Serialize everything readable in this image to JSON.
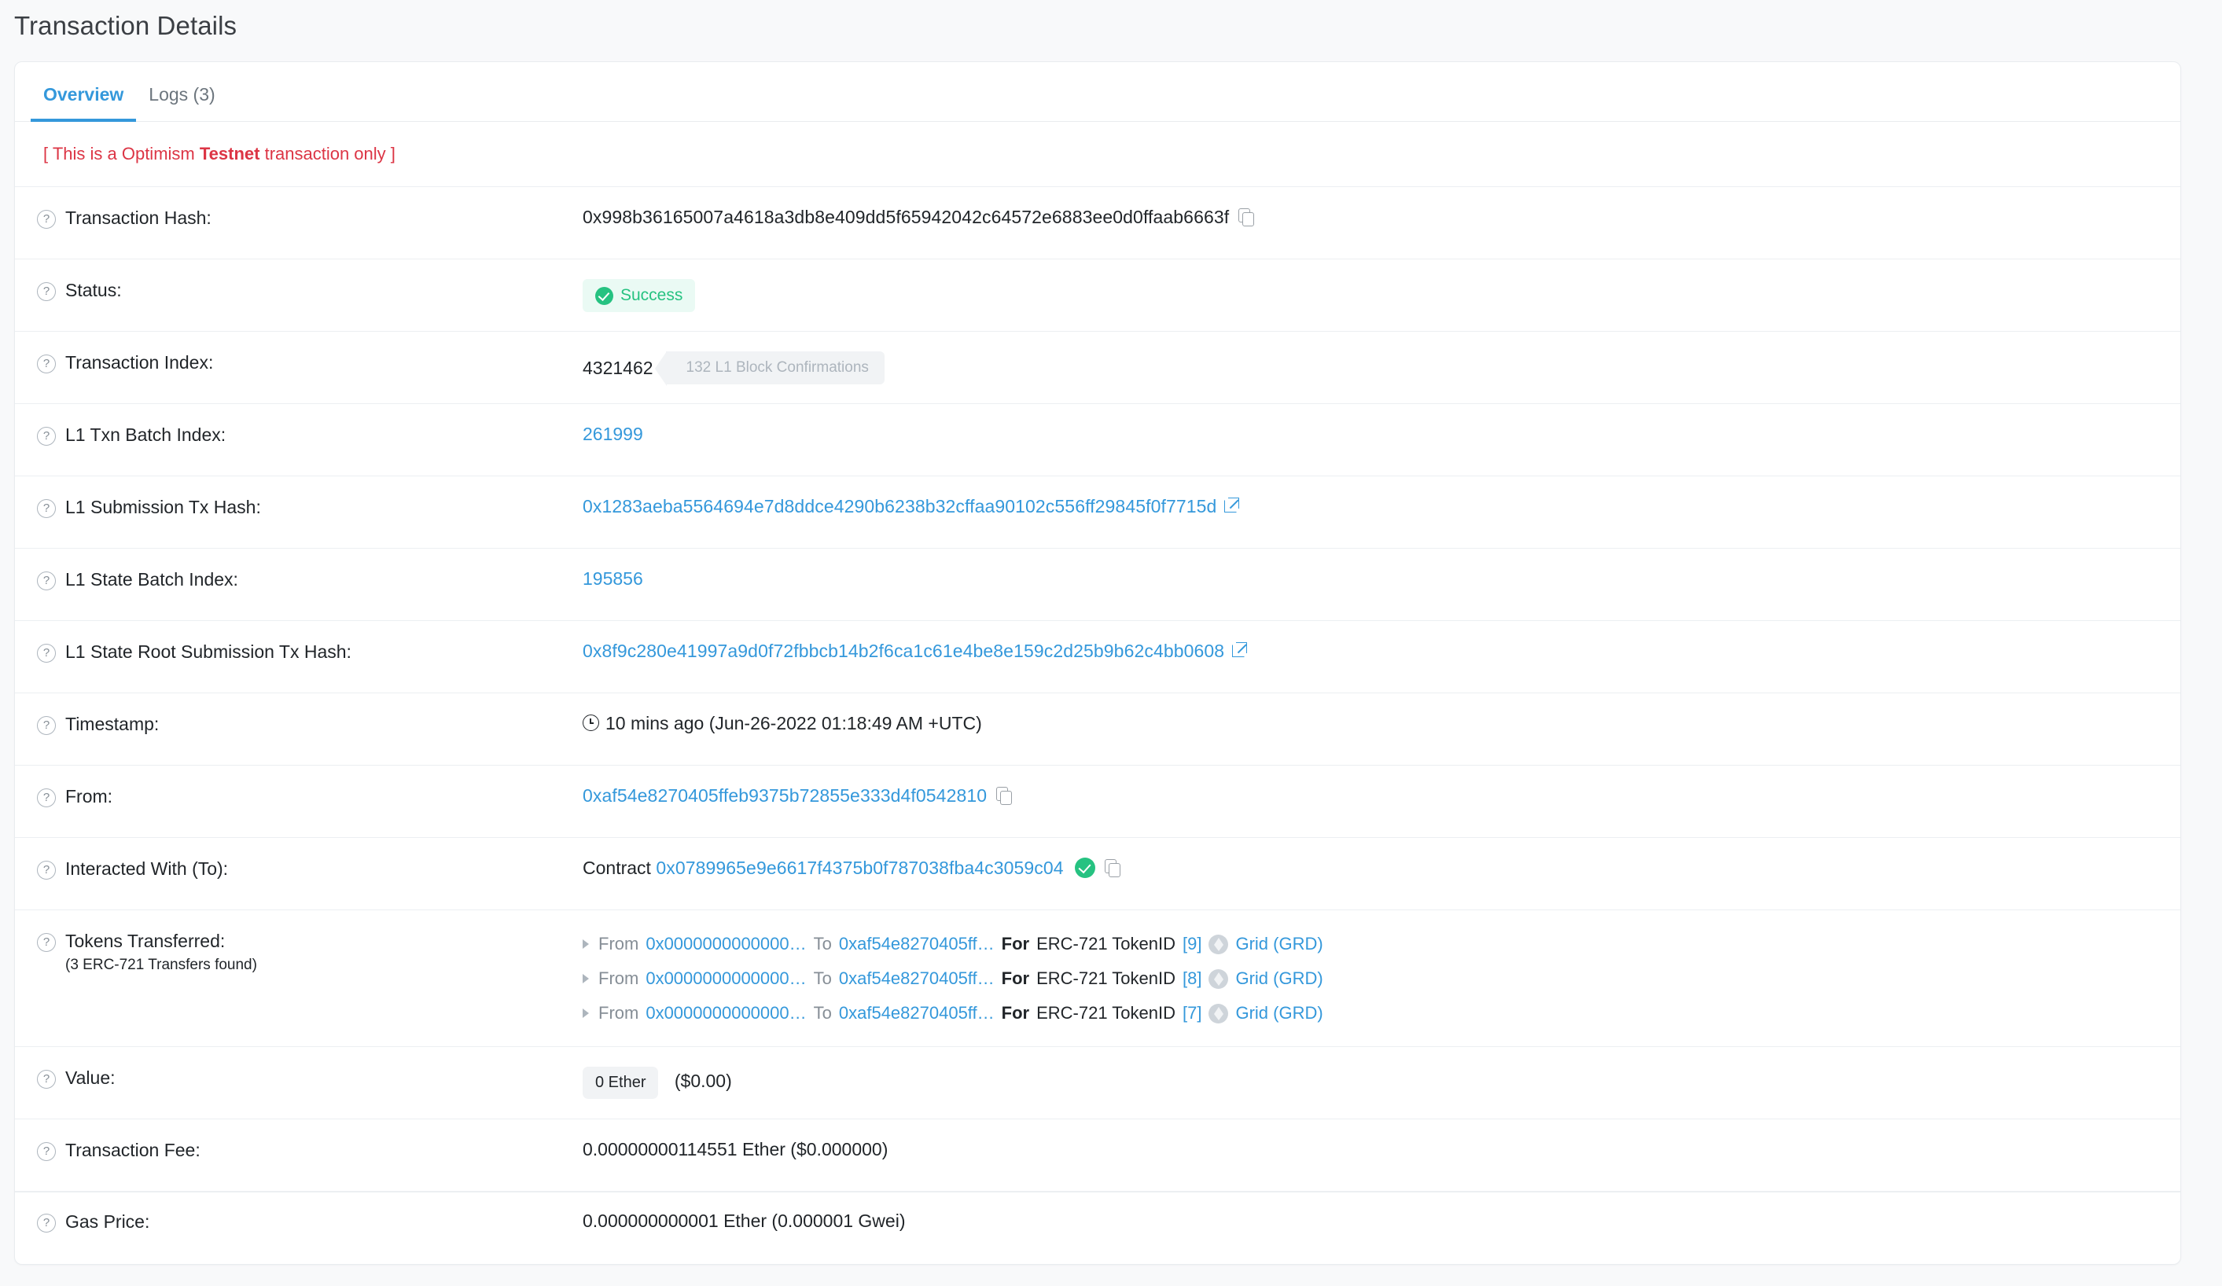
{
  "page_title": "Transaction Details",
  "tabs": [
    {
      "label": "Overview",
      "active": true
    },
    {
      "label": "Logs (3)",
      "active": false
    }
  ],
  "banner": {
    "prefix": "[ This is a Optimism ",
    "emphasis": "Testnet",
    "suffix": " transaction only ]",
    "color": "#dc3545"
  },
  "rows": {
    "tx_hash": {
      "label": "Transaction Hash:",
      "value": "0x998b36165007a4618a3db8e409dd5f65942042c64572e6883ee0d0ffaab6663f"
    },
    "status": {
      "label": "Status:",
      "value": "Success",
      "color": "#26c281"
    },
    "tx_index": {
      "label": "Transaction Index:",
      "value": "4321462",
      "confirmations": "132 L1 Block Confirmations"
    },
    "l1_txn_batch_index": {
      "label": "L1 Txn Batch Index:",
      "value": "261999"
    },
    "l1_submission_tx_hash": {
      "label": "L1 Submission Tx Hash:",
      "value": "0x1283aeba5564694e7d8ddce4290b6238b32cffaa90102c556ff29845f0f7715d"
    },
    "l1_state_batch_index": {
      "label": "L1 State Batch Index:",
      "value": "195856"
    },
    "l1_state_root_submission_tx_hash": {
      "label": "L1 State Root Submission Tx Hash:",
      "value": "0x8f9c280e41997a9d0f72fbbcb14b2f6ca1c61e4be8e159c2d25b9b62c4bb0608"
    },
    "timestamp": {
      "label": "Timestamp:",
      "value": "10 mins ago (Jun-26-2022 01:18:49 AM +UTC)"
    },
    "from": {
      "label": "From:",
      "value": "0xaf54e8270405ffeb9375b72855e333d4f0542810"
    },
    "to": {
      "label": "Interacted With (To):",
      "prefix": "Contract",
      "value": "0x0789965e9e6617f4375b0f787038fba4c3059c04"
    },
    "tokens_transferred": {
      "label": "Tokens Transferred:",
      "sublabel": "(3 ERC-721 Transfers found)",
      "transfers": [
        {
          "from_word": "From",
          "from": "0x0000000000000…",
          "to_word": "To",
          "to": "0xaf54e8270405ff…",
          "for_word": "For",
          "standard": "ERC-721 TokenID",
          "token_id": "[9]",
          "token_name": "Grid (GRD)"
        },
        {
          "from_word": "From",
          "from": "0x0000000000000…",
          "to_word": "To",
          "to": "0xaf54e8270405ff…",
          "for_word": "For",
          "standard": "ERC-721 TokenID",
          "token_id": "[8]",
          "token_name": "Grid (GRD)"
        },
        {
          "from_word": "From",
          "from": "0x0000000000000…",
          "to_word": "To",
          "to": "0xaf54e8270405ff…",
          "for_word": "For",
          "standard": "ERC-721 TokenID",
          "token_id": "[7]",
          "token_name": "Grid (GRD)"
        }
      ]
    },
    "value": {
      "label": "Value:",
      "amount": "0 Ether",
      "fiat": "($0.00)"
    },
    "tx_fee": {
      "label": "Transaction Fee:",
      "value": "0.00000000114551 Ether ($0.000000)"
    },
    "gas_price": {
      "label": "Gas Price:",
      "value": "0.000000000001 Ether (0.000001 Gwei)"
    }
  },
  "icons": {
    "help": "?",
    "copy": "copy-icon",
    "external": "external-link-icon",
    "clock": "clock-icon",
    "check": "check-circle-icon",
    "caret": "caret-right-icon",
    "token": "token-ether-icon"
  }
}
